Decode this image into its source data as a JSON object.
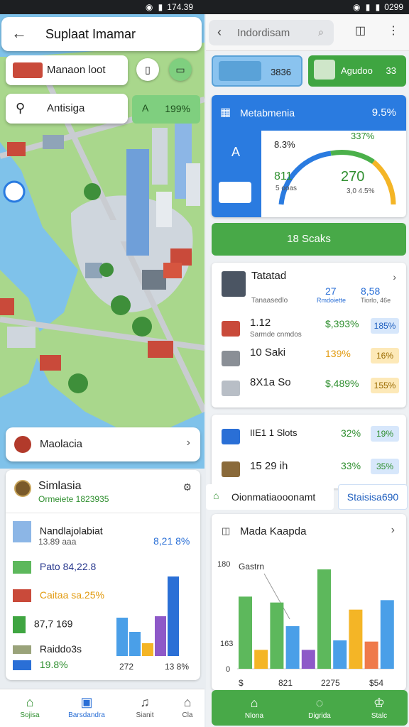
{
  "status_bar": {
    "left_time": "174.39",
    "right_time": "0299"
  },
  "left": {
    "title": "Suplaat Imamar",
    "chip_top": "Manaon loot",
    "chip_second": "Antisiga",
    "badge_label": "A",
    "badge_value": "199%",
    "location_card": "Maolacia",
    "sim": {
      "title": "Simlasia",
      "subtitle": "Ormeiete 1823935",
      "rows": [
        {
          "label": "Nandlajolabiat",
          "sub": "13.89 aaa",
          "value": "8,21 8%"
        },
        {
          "label": "Pato 84,22.8"
        },
        {
          "label": "Caitaa sa.25%"
        },
        {
          "label": "87,7 169"
        },
        {
          "label": "Raiddo3s"
        },
        {
          "label": "19.8%"
        }
      ],
      "chart_axis_left": "272",
      "chart_axis_right": "13 8%",
      "mini_values": [
        48,
        30,
        16,
        50,
        100
      ],
      "mini_colors": [
        "#4a9fe8",
        "#4a9fe8",
        "#f4b526",
        "#8e59c8",
        "#2a6fd6"
      ]
    },
    "nav": [
      "Sojisa",
      "Barsdandra",
      "Sianit",
      "Cla"
    ]
  },
  "right": {
    "search_text": "Indordisam",
    "tile1_value": "3836",
    "tile2_label": "Agudoo",
    "tile2_value": "33",
    "metric": {
      "title": "Metabmenia",
      "value": "9.5%",
      "side_label": "A",
      "gauge_left_top": "8.3%",
      "gauge_right_top": "337%",
      "gauge_left_value": "811",
      "gauge_left_sub": "5 ooas",
      "gauge_right_value": "270",
      "gauge_right_sub": "3,0 4.5%"
    },
    "green_button": "18 Scaks",
    "list": [
      {
        "label": "Tatatad",
        "sub": "Tanaasedlo",
        "v1": "27",
        "v1s": "Rmdoiette",
        "v2": "8,58",
        "v2s": "Tiorlo, 46e"
      },
      {
        "label": "1.12",
        "sub": "Sarmde cnmdos",
        "v1": "$,393%",
        "pill": "185%"
      },
      {
        "label": "10 Saki",
        "sub": "",
        "v1": "139%",
        "pill": "16%"
      },
      {
        "label": "8X1a So",
        "sub": "",
        "v1": "$,489%",
        "pill": "155%"
      }
    ],
    "list2": [
      {
        "label": "IIE1 1 Slots",
        "v1": "32%",
        "pill": "19%"
      },
      {
        "label": "15 29 ih",
        "v1": "33%",
        "pill": "35%"
      }
    ],
    "strip_left": "Oionmatiaooonamt",
    "strip_right": "Staisisa690",
    "chart_title": "Mada Kaapda",
    "chart_data": {
      "type": "bar",
      "title": "Mada Kaapda",
      "series_label": "Gastrn",
      "y_tick_top": "180",
      "y_tick_mid": "163",
      "y_tick_zero": "0",
      "x_labels": [
        "$",
        "821",
        "2275",
        "$54"
      ],
      "ylim": [
        0,
        180
      ],
      "values": [
        122,
        32,
        112,
        72,
        32,
        168,
        48,
        100,
        46,
        116
      ],
      "colors": [
        "#5db85c",
        "#f4b526",
        "#5db85c",
        "#4a9fe8",
        "#8e59c8",
        "#5db85c",
        "#4a9fe8",
        "#f4b526",
        "#ef7a4a",
        "#4a9fe8"
      ]
    },
    "nav": [
      "Nlona",
      "Digrida",
      "Stalc"
    ]
  }
}
